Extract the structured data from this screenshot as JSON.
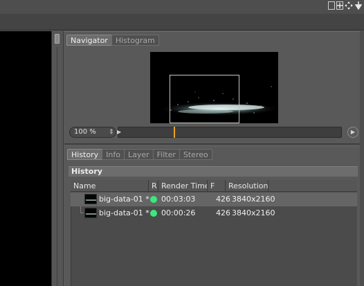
{
  "toolbar": {
    "icons": [
      "panel-icon",
      "plus-box-icon",
      "move-icon",
      "arrow-down-icon"
    ]
  },
  "navigator": {
    "tabs": [
      {
        "label": "Navigator",
        "active": true
      },
      {
        "label": "Histogram",
        "active": false
      }
    ],
    "zoom_value": "100 %",
    "zoom_level_fraction": 0.25
  },
  "history": {
    "tabs": [
      {
        "label": "History",
        "active": true
      },
      {
        "label": "Info",
        "active": false
      },
      {
        "label": "Layer",
        "active": false
      },
      {
        "label": "Filter",
        "active": false
      },
      {
        "label": "Stereo",
        "active": false
      }
    ],
    "section_title": "History",
    "columns": [
      "Name",
      "R",
      "Render Time",
      "F",
      "Resolution"
    ],
    "rows": [
      {
        "name": "big-data-01 *",
        "render_time": "00:03:03",
        "frame": "426",
        "resolution": "3840x2160",
        "status_color": "#3be87f"
      },
      {
        "name": "big-data-01 *",
        "render_time": "00:00:26",
        "frame": "426",
        "resolution": "3840x2160",
        "status_color": "#3be87f"
      }
    ]
  },
  "colors": {
    "accent_orange": "#f0a020",
    "status_green": "#3be87f",
    "panel_bg": "#595959"
  }
}
